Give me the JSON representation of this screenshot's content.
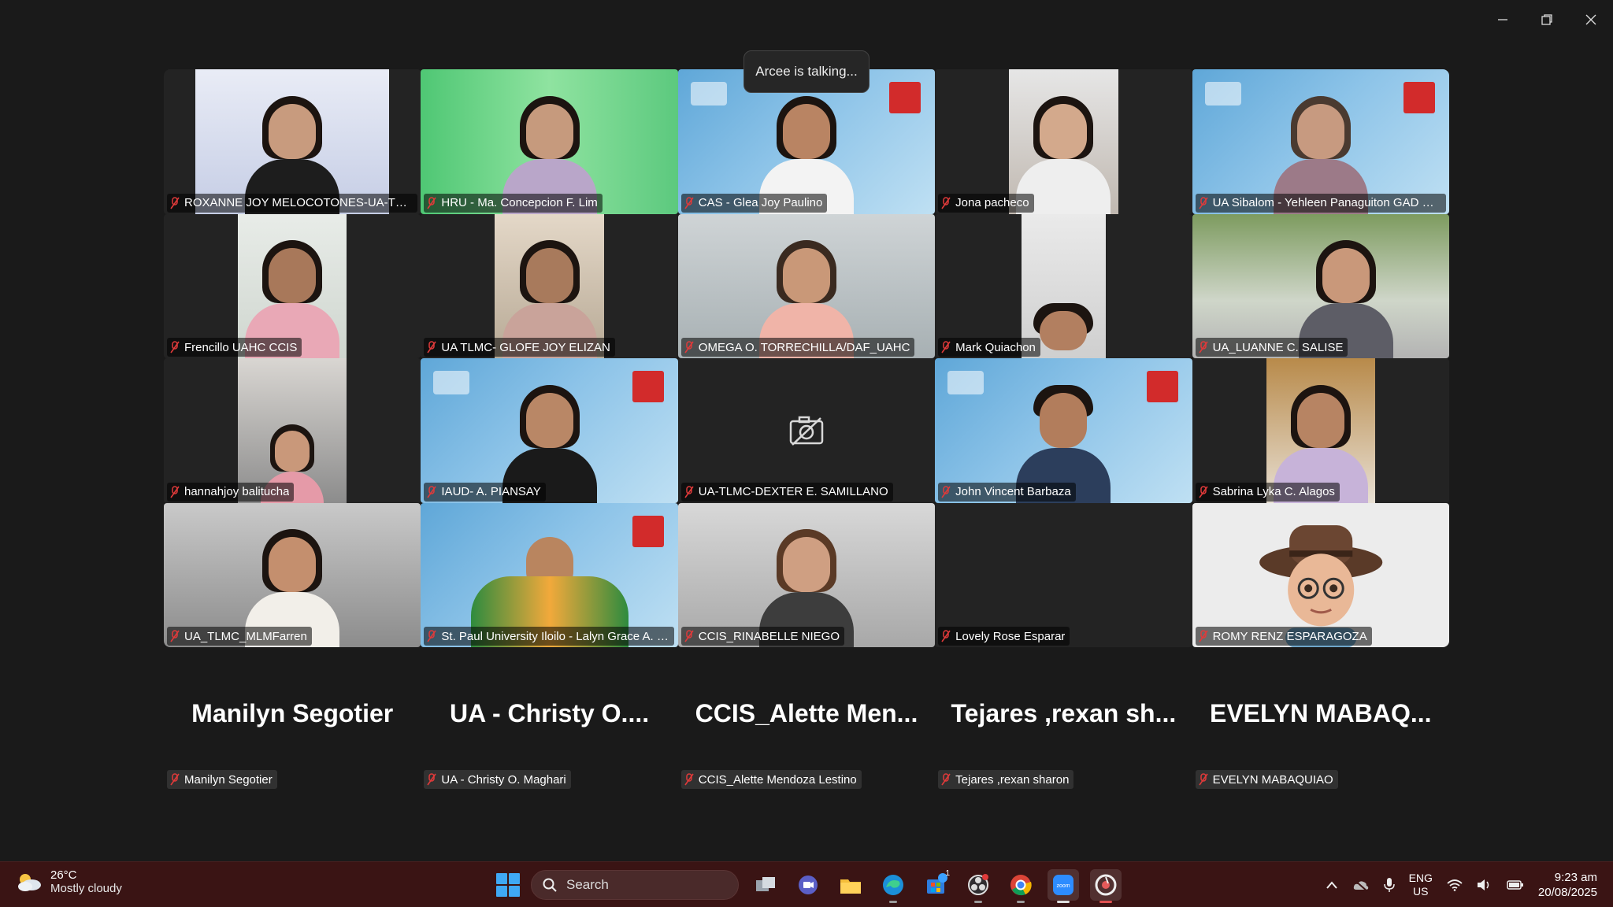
{
  "talking_indicator": "Arcee is talking...",
  "window_controls": {
    "minimize": "minimize-icon",
    "restore": "restore-icon",
    "close": "close-icon"
  },
  "gallery": [
    {
      "name": "ROXANNE JOY MELOCOTONES-UA-TLMC",
      "muted": true
    },
    {
      "name": "HRU - Ma. Concepcion F. Lim",
      "muted": true
    },
    {
      "name": "CAS - Glea Joy Paulino",
      "muted": true
    },
    {
      "name": "Jona pacheco",
      "muted": true
    },
    {
      "name": "UA Sibalom - Yehleen Panaguiton GAD Fo...",
      "muted": true
    },
    {
      "name": "Frencillo UAHC CCIS",
      "muted": true
    },
    {
      "name": "UA TLMC- GLOFE JOY ELIZAN",
      "muted": true
    },
    {
      "name": "OMEGA O. TORRECHILLA/DAF_UAHC",
      "muted": true
    },
    {
      "name": "Mark Quiachon",
      "muted": true
    },
    {
      "name": "UA_LUANNE C. SALISE",
      "muted": true
    },
    {
      "name": "hannahjoy balitucha",
      "muted": true
    },
    {
      "name": "IAUD- A. PIANSAY",
      "muted": true
    },
    {
      "name": "UA-TLMC-DEXTER E. SAMILLANO",
      "muted": true,
      "camera_off": true
    },
    {
      "name": "John Vincent Barbaza",
      "muted": true
    },
    {
      "name": "Sabrina Lyka C. Alagos",
      "muted": true
    },
    {
      "name": "UA_TLMC_MLMFarren",
      "muted": true
    },
    {
      "name": "St. Paul University Iloilo - Lalyn Grace A. Se...",
      "muted": true
    },
    {
      "name": "CCIS_RINABELLE NIEGO",
      "muted": true
    },
    {
      "name": "Lovely Rose Esparar",
      "muted": true
    },
    {
      "name": "ROMY RENZ ESPARAGOZA",
      "muted": true
    }
  ],
  "audio_only": [
    {
      "display": "Manilyn Segotier",
      "tag": "Manilyn Segotier"
    },
    {
      "display": "UA - Christy O....",
      "tag": "UA - Christy O. Maghari"
    },
    {
      "display": "CCIS_Alette Men...",
      "tag": "CCIS_Alette Mendoza Lestino"
    },
    {
      "display": "Tejares ,rexan sh...",
      "tag": "Tejares ,rexan sharon"
    },
    {
      "display": "EVELYN MABAQ...",
      "tag": "EVELYN MABAQUIAO"
    }
  ],
  "taskbar": {
    "weather_temp": "26°C",
    "weather_cond": "Mostly cloudy",
    "search_label": "Search",
    "lang_top": "ENG",
    "lang_bottom": "US",
    "time": "9:23 am",
    "date": "20/08/2025",
    "store_badge": "1"
  },
  "colors": {
    "muted_mic": "#e03a3a",
    "taskbar_bg": "#3a1414",
    "accent": "#3fa9f5"
  }
}
